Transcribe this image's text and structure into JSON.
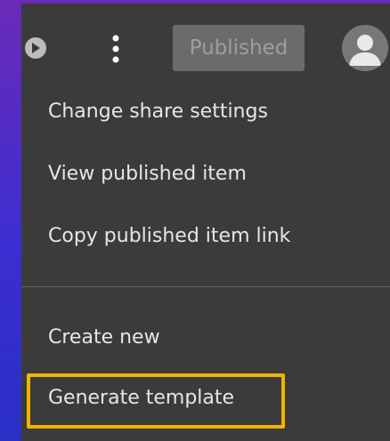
{
  "toolbar": {
    "play_icon": "play-circle-icon",
    "more_icon": "vertical-ellipsis-icon",
    "status_badge": "Published",
    "avatar_icon": "user-avatar-icon"
  },
  "menu": {
    "items": [
      {
        "label": "Change share settings"
      },
      {
        "label": "View published item"
      },
      {
        "label": "Copy published item link"
      },
      {
        "label": "Create new"
      },
      {
        "label": "Generate template"
      }
    ]
  },
  "highlight": {
    "color": "#f2b400",
    "target": "Generate template"
  },
  "colors": {
    "panel_bg": "#3b3b3b",
    "text": "#e6e6e6",
    "badge_bg": "#6b6b6b",
    "badge_text": "#9e9e9e",
    "background_gradient": [
      "#6a2bb8",
      "#2a2fc6"
    ]
  }
}
